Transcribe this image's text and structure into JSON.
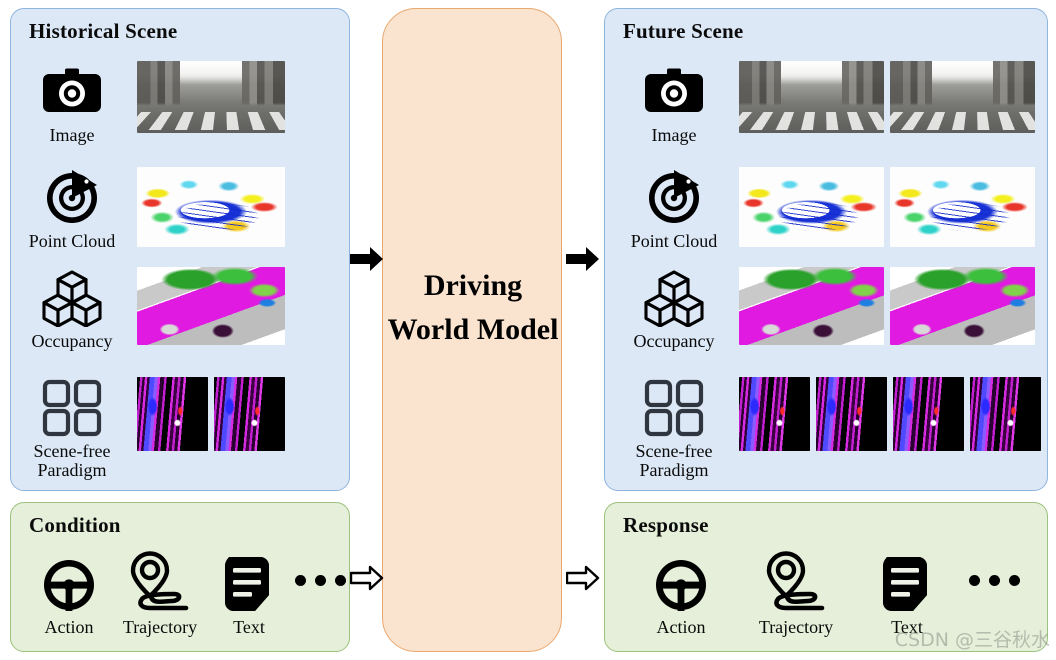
{
  "diagram": {
    "title_hidden": "Driving World Model pipeline",
    "colors": {
      "scene_panel_bg": "#dce8f6",
      "scene_panel_border": "#8fb4dd",
      "condition_panel_bg": "#e5efd9",
      "condition_panel_border": "#9dc27f",
      "model_panel_bg": "#fae3cf",
      "model_panel_border": "#e9a86e",
      "icon_black": "#000000",
      "scene_free_icon": "#2f3640"
    }
  },
  "historical": {
    "title": "Historical Scene",
    "modalities": [
      {
        "label": "Image",
        "icon": "camera-icon",
        "frames": 1,
        "art": "t-street"
      },
      {
        "label": "Point Cloud",
        "icon": "radar-icon",
        "frames": 1,
        "art": "t-lidar"
      },
      {
        "label": "Occupancy",
        "icon": "cubes-icon",
        "frames": 1,
        "art": "t-occ"
      },
      {
        "label": "Scene-free\nParadigm",
        "icon": "grid-squares-icon",
        "frames": 2,
        "art": "t-free"
      }
    ]
  },
  "future": {
    "title": "Future Scene",
    "modalities": [
      {
        "label": "Image",
        "icon": "camera-icon",
        "frames": 2,
        "art": "t-street"
      },
      {
        "label": "Point Cloud",
        "icon": "radar-icon",
        "frames": 2,
        "art": "t-lidar"
      },
      {
        "label": "Occupancy",
        "icon": "cubes-icon",
        "frames": 2,
        "art": "t-occ"
      },
      {
        "label": "Scene-free\nParadigm",
        "icon": "grid-squares-icon",
        "frames": 4,
        "art": "t-free"
      }
    ]
  },
  "condition": {
    "title": "Condition",
    "items": [
      {
        "label": "Action",
        "icon": "steering-wheel-icon"
      },
      {
        "label": "Trajectory",
        "icon": "map-pin-route-icon"
      },
      {
        "label": "Text",
        "icon": "document-text-icon"
      }
    ],
    "more": "..."
  },
  "response": {
    "title": "Response",
    "items": [
      {
        "label": "Action",
        "icon": "steering-wheel-icon"
      },
      {
        "label": "Trajectory",
        "icon": "map-pin-route-icon"
      },
      {
        "label": "Text",
        "icon": "document-text-icon"
      }
    ],
    "more": "..."
  },
  "model": {
    "label": "Driving\nWorld\nModel"
  },
  "arrows": [
    {
      "name": "arrow-scene-in",
      "style": "solid"
    },
    {
      "name": "arrow-scene-out",
      "style": "solid"
    },
    {
      "name": "arrow-condition-in",
      "style": "hollow"
    },
    {
      "name": "arrow-response-out",
      "style": "hollow"
    }
  ],
  "watermark": {
    "text": "CSDN @三谷秋水"
  }
}
